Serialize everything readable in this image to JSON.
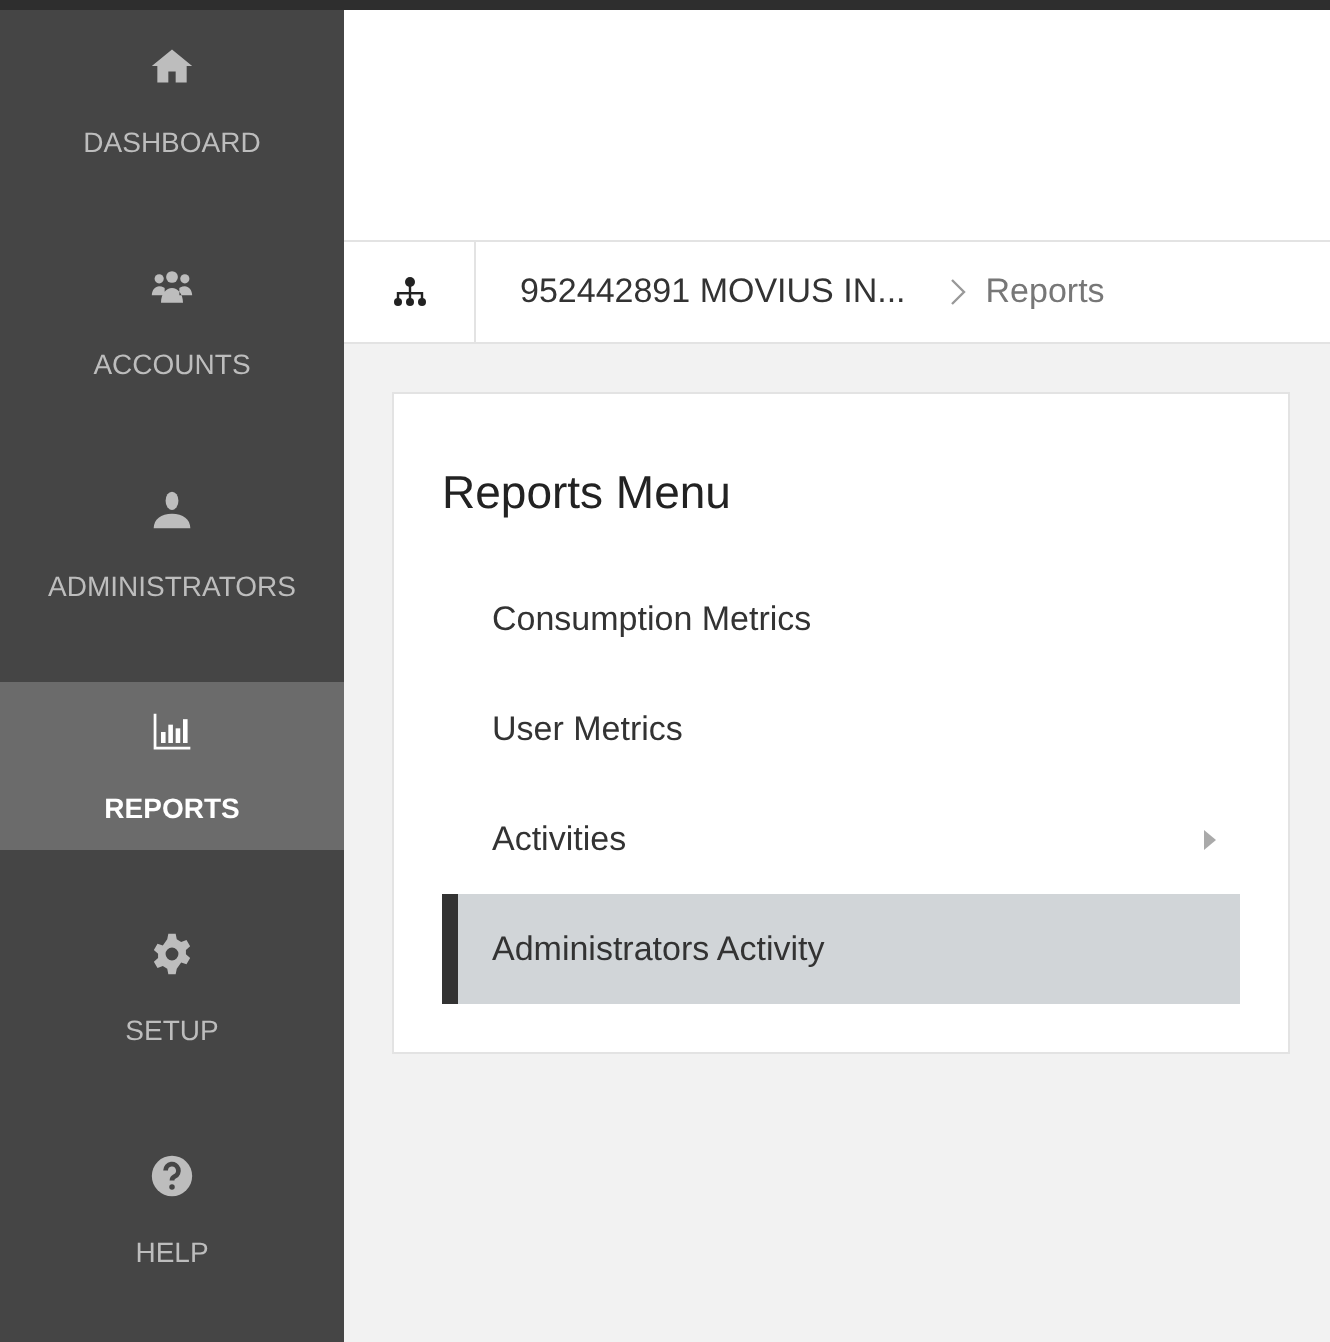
{
  "sidebar": {
    "items": [
      {
        "kind": "home",
        "label": "DASHBOARD",
        "selected": false
      },
      {
        "kind": "group",
        "label": "ACCOUNTS",
        "selected": false
      },
      {
        "kind": "person",
        "label": "ADMINISTRATORS",
        "selected": false
      },
      {
        "kind": "chart",
        "label": "REPORTS",
        "selected": true
      },
      {
        "kind": "gear",
        "label": "SETUP",
        "selected": false
      },
      {
        "kind": "help",
        "label": "HELP",
        "selected": false
      }
    ]
  },
  "breadcrumb": {
    "items": [
      "952442891 MOVIUS IN...",
      "Reports"
    ]
  },
  "reports_menu": {
    "title": "Reports Menu",
    "items": [
      {
        "label": "Consumption Metrics",
        "selected": false,
        "submenu": false
      },
      {
        "label": "User Metrics",
        "selected": false,
        "submenu": false
      },
      {
        "label": "Activities",
        "selected": false,
        "submenu": true
      },
      {
        "label": "Administrators Activity",
        "selected": true,
        "submenu": false
      }
    ]
  }
}
